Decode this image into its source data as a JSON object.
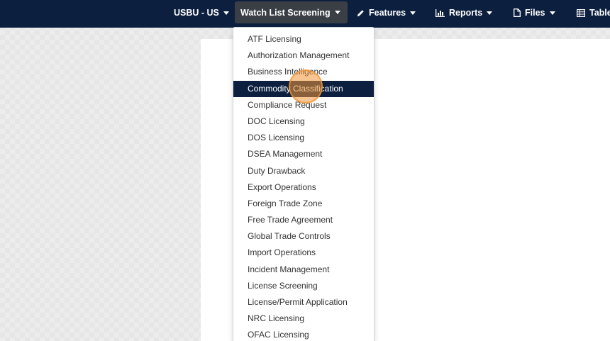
{
  "colors": {
    "topbar_bg": "#0c1f3f",
    "active_nav_bg": "#3a3f46",
    "highlight_bg": "#0c1f3f",
    "click_indicator": "#f19636"
  },
  "topnav": {
    "org_selector": "USBU - US",
    "watch_list_screening": "Watch List Screening",
    "features": "Features",
    "reports": "Reports",
    "files": "Files",
    "tables": "Table"
  },
  "icons": {
    "features": "pencil-icon",
    "reports": "bar-chart-icon",
    "files": "file-icon",
    "tables": "table-icon",
    "caret": "caret-down-icon"
  },
  "dropdown": {
    "highlighted_index": 3,
    "items": [
      "ATF Licensing",
      "Authorization Management",
      "Business Intelligence",
      "Commodity Classification",
      "Compliance Request",
      "DOC Licensing",
      "DOS Licensing",
      "DSEA Management",
      "Duty Drawback",
      "Export Operations",
      "Foreign Trade Zone",
      "Free Trade Agreement",
      "Global Trade Controls",
      "Import Operations",
      "Incident Management",
      "License Screening",
      "License/Permit Application",
      "NRC Licensing",
      "OFAC Licensing"
    ]
  }
}
